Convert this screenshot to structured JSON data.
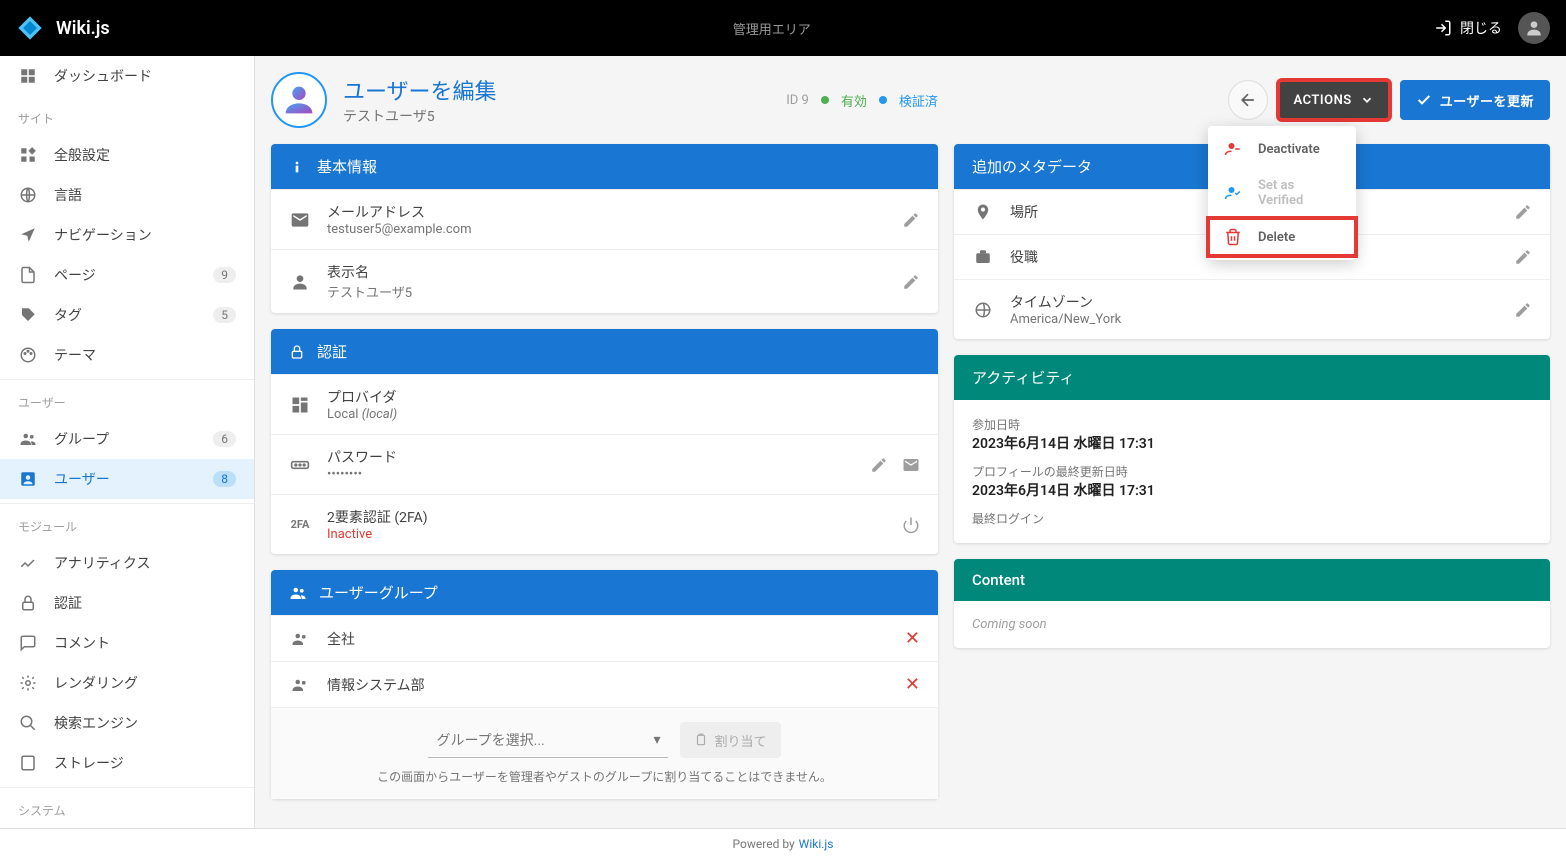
{
  "topbar": {
    "brand": "Wiki.js",
    "center": "管理用エリア",
    "close": "閉じる"
  },
  "sidebar": {
    "dashboard": "ダッシュボード",
    "sections": {
      "site": "サイト",
      "users": "ユーザー",
      "modules": "モジュール",
      "system": "システム"
    },
    "items": {
      "general": "全般設定",
      "language": "言語",
      "navigation": "ナビゲーション",
      "pages": {
        "label": "ページ",
        "badge": "9"
      },
      "tags": {
        "label": "タグ",
        "badge": "5"
      },
      "theme": "テーマ",
      "groups": {
        "label": "グループ",
        "badge": "6"
      },
      "users_item": {
        "label": "ユーザー",
        "badge": "8"
      },
      "analytics": "アナリティクス",
      "auth": "認証",
      "comments": "コメント",
      "rendering": "レンダリング",
      "searchEngine": "検索エンジン",
      "storage": "ストレージ"
    }
  },
  "page": {
    "title": "ユーザーを編集",
    "subtitle": "テストユーザ5",
    "id_label": "ID 9",
    "enabled": "有効",
    "verified": "検証済",
    "actions_btn": "Actions",
    "update_btn": "ユーザーを更新"
  },
  "actions_menu": {
    "deactivate": "Deactivate",
    "verify": "Set as Verified",
    "delete": "Delete"
  },
  "basic": {
    "header": "基本情報",
    "email_label": "メールアドレス",
    "email_value": "testuser5@example.com",
    "name_label": "表示名",
    "name_value": "テストユーザ5"
  },
  "auth": {
    "header": "認証",
    "provider_label": "プロバイダ",
    "provider_value": "Local ",
    "provider_suffix": "(local)",
    "password_label": "パスワード",
    "password_value": "••••••••",
    "tfa_label": "2要素認証 (2FA)",
    "tfa_value": "Inactive",
    "tfa_tag": "2FA"
  },
  "groups": {
    "header": "ユーザーグループ",
    "items": [
      "全社",
      "情報システム部"
    ],
    "select_placeholder": "グループを選択...",
    "assign_btn": "割り当て",
    "note": "この画面からユーザーを管理者やゲストのグループに割り当てることはできません。"
  },
  "meta": {
    "header": "追加のメタデータ",
    "location": "場所",
    "job": "役職",
    "tz_label": "タイムゾーン",
    "tz_value": "America/New_York"
  },
  "activity": {
    "header": "アクティビティ",
    "joined_label": "参加日時",
    "joined_value": "2023年6月14日 水曜日 17:31",
    "updated_label": "プロフィールの最終更新日時",
    "updated_value": "2023年6月14日 水曜日 17:31",
    "lastlogin_label": "最終ログイン"
  },
  "content": {
    "header": "Content",
    "body": "Coming soon"
  },
  "footer": {
    "prefix": "Powered by",
    "link": "Wiki.js"
  }
}
